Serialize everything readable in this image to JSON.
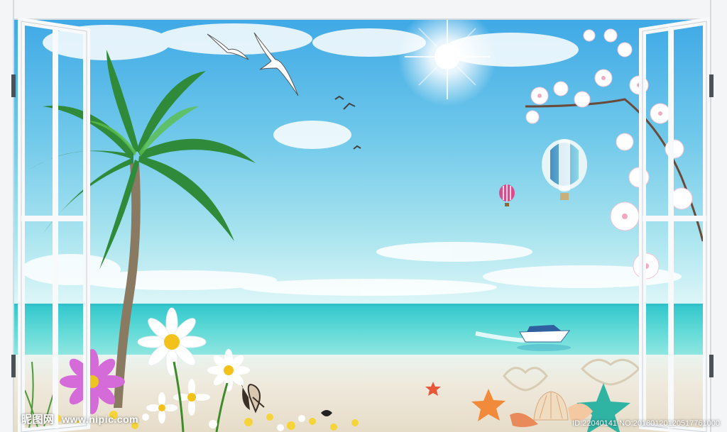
{
  "watermark": {
    "logo_text": "昵图网",
    "url": "www.nipic.com",
    "id_line": "ID:22040141 NO:20180120120517761000"
  },
  "colors": {
    "sky_top": "#3fa9e6",
    "sea": "#2fc6cc",
    "sand": "#efe9dc",
    "frame": "#f3f5f6"
  },
  "icons": [
    "sun-icon",
    "seagull-icon",
    "palm-tree-icon",
    "hot-air-balloon-icon",
    "speedboat-icon",
    "daisy-icon",
    "cosmos-flower-icon",
    "butterfly-icon",
    "starfish-icon",
    "seashell-icon",
    "blossom-branch-icon",
    "open-window-frame"
  ]
}
